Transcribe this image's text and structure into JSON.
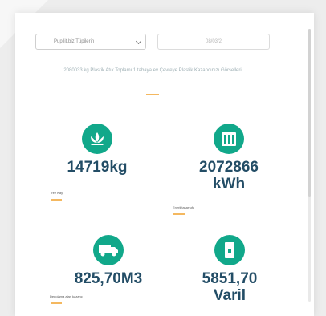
{
  "filters": {
    "select_value": "Pupilit.biz Tüpilerin",
    "date_value": "08/03/2"
  },
  "description": "2080033 kg Plastik Atık Toplamı 1 tabaya ev Çevreye Plastik Kazancınızı Görselleri",
  "stats": [
    {
      "value": "14719kg",
      "label": "Tree Kayı",
      "icon": "lotus-icon"
    },
    {
      "value": "2072866",
      "value2": "kWh",
      "label": "Enerji tasarrufu",
      "icon": "building-icon"
    },
    {
      "value": "825,70M3",
      "label": "Depolama alan kazanç",
      "icon": "truck-icon"
    },
    {
      "value": "5851,70",
      "value2": "Varil",
      "label": "",
      "icon": "oil-barrel-icon"
    }
  ],
  "colors": {
    "accent": "#11a88a",
    "value_text": "#234d66",
    "underline": "#f4b860"
  }
}
